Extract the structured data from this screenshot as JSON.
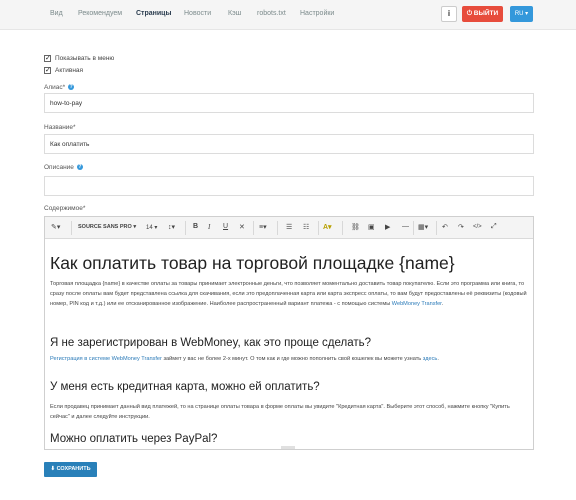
{
  "nav": {
    "items": [
      "Вид",
      "Рекомендуем",
      "Страницы",
      "Новости",
      "Кэш",
      "robots.txt",
      "Настройки"
    ],
    "active": "Страницы",
    "info_label": "i",
    "logout_label": "ВЫЙТИ",
    "lang_label": "RU"
  },
  "form": {
    "show_in_menu_label": "Показывать в меню",
    "active_label": "Активная",
    "alias_label": "Алиас*",
    "alias_value": "how-to-pay",
    "title_label": "Название*",
    "title_value": "Как оплатить",
    "description_label": "Описание",
    "description_value": "",
    "content_label": "Содержимое*"
  },
  "toolbar": {
    "font_label": "SOURCE SANS PRO",
    "size_label": "14"
  },
  "content": {
    "heading": "Как оплатить товар на торговой площадке {name}",
    "intro": "Торговая площадка {name} в качестве оплаты за товары принимает электронные деньги, что позволяет моментально доставить товар покупателю. Если это программа или книга, то сразу после оплаты вам будет представлена ссылка для скачивания, если это предоплаченная карта или карта экспресс оплаты, то вам будут предоставлены её реквизиты (кодовый номер, PIN код и т.д.) или ее отсканированное изображение. Наиболее распространенный вариант платежа - с помощью системы",
    "intro_link": "WebMoney Transfer",
    "h_wm": "Я не зарегистрирован в WebMoney, как это проще сделать?",
    "wm_link": "Регистрация в системе WebMoney Transfer",
    "wm_text": "займет у вас не более 2-х минут. О том как и где можно пополнить свой кошелек вы можете узнать",
    "wm_link2": "здесь",
    "h_card": "У меня есть кредитная карта, можно ей оплатить?",
    "card_text": "Если продавец принимает данный вид платежей, то на странице оплаты товара в форме оплаты вы увидите \"Кредитная карта\". Выберите этот способ, нажмите кнопку \"Купить сейчас\" и далее следуйте инструкции.",
    "h_paypal": "Можно оплатить через PayPal?"
  },
  "save_label": "СОХРАНИТЬ",
  "colors": {
    "danger": "#e74c3c",
    "primary": "#3498db",
    "save": "#2980b9",
    "link": "#2a7ab8"
  }
}
